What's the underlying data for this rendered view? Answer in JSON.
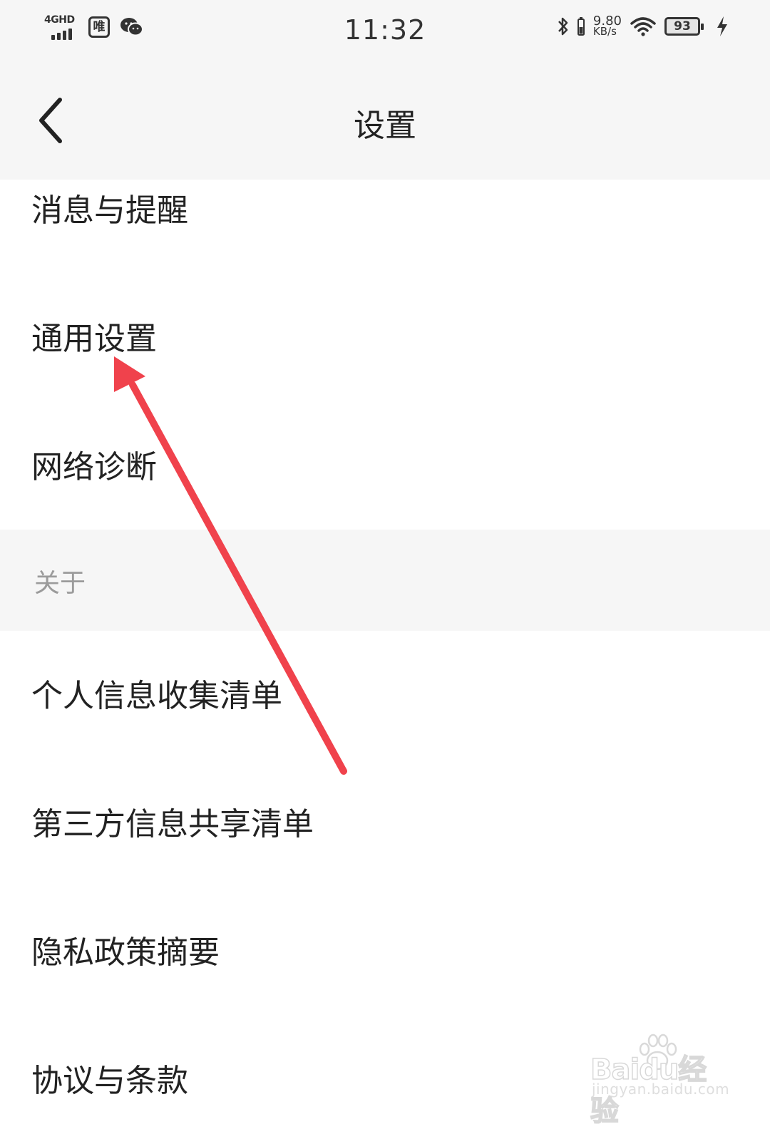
{
  "status_bar": {
    "network": "4GHD",
    "app_badge": "唯",
    "time": "11:32",
    "speed_value": "9.80",
    "speed_unit": "KB/s",
    "battery": "93",
    "icons": [
      "signal-icon",
      "wechat-icon",
      "bluetooth-icon",
      "phone-battery-small-icon",
      "wifi-icon",
      "battery-icon",
      "charging-icon"
    ]
  },
  "nav": {
    "title": "设置",
    "back_icon": "chevron-left-icon"
  },
  "items_top": [
    {
      "label": "消息与提醒"
    },
    {
      "label": "通用设置"
    },
    {
      "label": "网络诊断"
    }
  ],
  "section": {
    "label": "关于"
  },
  "items_about": [
    {
      "label": "个人信息收集清单"
    },
    {
      "label": "第三方信息共享清单"
    },
    {
      "label": "隐私政策摘要"
    },
    {
      "label": "协议与条款"
    }
  ],
  "annotation": {
    "color": "#f0424c"
  },
  "watermark": {
    "brand": "Baidu经验",
    "url": "jingyan.baidu.com"
  }
}
